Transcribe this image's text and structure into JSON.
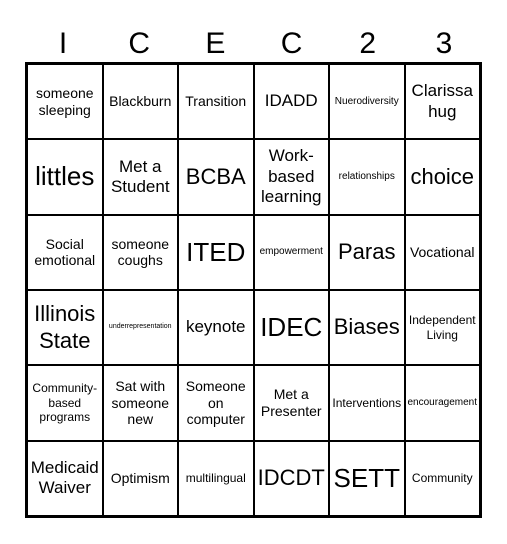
{
  "header": [
    "I",
    "C",
    "E",
    "C",
    "2",
    "3"
  ],
  "cells": [
    [
      "someone sleeping",
      "Blackburn",
      "Transition",
      "IDADD",
      "Nuerodiversity",
      "Clarissa hug"
    ],
    [
      "littles",
      "Met a Student",
      "BCBA",
      "Work-based learning",
      "relationships",
      "choice"
    ],
    [
      "Social emotional",
      "someone coughs",
      "ITED",
      "empowerment",
      "Paras",
      "Vocational"
    ],
    [
      "Illinois State",
      "underrepresentation",
      "keynote",
      "IDEC",
      "Biases",
      "Independent Living"
    ],
    [
      "Community-based programs",
      "Sat with someone new",
      "Someone on computer",
      "Met a Presenter",
      "Interventions",
      "encouragement"
    ],
    [
      "Medicaid Waiver",
      "Optimism",
      "multilingual",
      "IDCDT",
      "SETT",
      "Community"
    ]
  ]
}
